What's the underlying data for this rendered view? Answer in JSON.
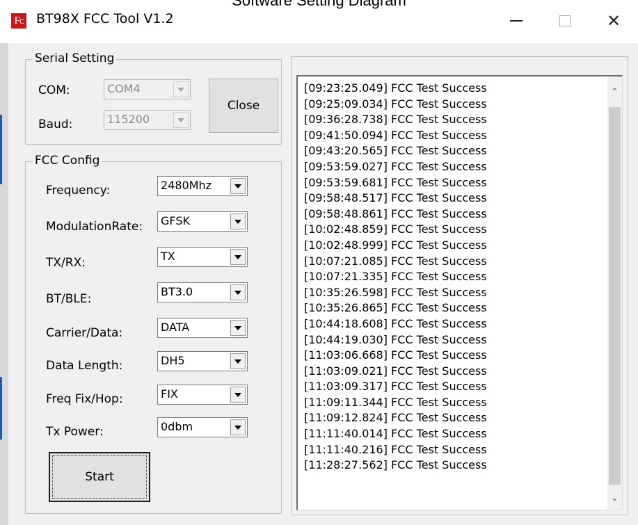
{
  "caption": "Software Setting Diagram",
  "window": {
    "title": "BT98X FCC Tool V1.2",
    "icon_text": "Fc",
    "minimize_icon": "minimize-icon",
    "maximize_icon": "maximize-icon",
    "close_glyph": "✕"
  },
  "serial": {
    "legend": "Serial Setting",
    "com_label": "COM:",
    "com_value": "COM4",
    "baud_label": "Baud:",
    "baud_value": "115200",
    "close_button": "Close"
  },
  "fcc": {
    "legend": "FCC Config",
    "fields": [
      {
        "label": "Frequency:",
        "value": "2480Mhz"
      },
      {
        "label": "ModulationRate:",
        "value": "GFSK"
      },
      {
        "label": "TX/RX:",
        "value": "TX"
      },
      {
        "label": "BT/BLE:",
        "value": "BT3.0"
      },
      {
        "label": "Carrier/Data:",
        "value": "DATA"
      },
      {
        "label": "Data Length:",
        "value": "DH5"
      },
      {
        "label": "Freq Fix/Hop:",
        "value": "FIX"
      },
      {
        "label": "Tx Power:",
        "value": "0dbm"
      }
    ],
    "start_button": "Start"
  },
  "log": {
    "lines": [
      "[09:23:25.049] FCC Test Success",
      "[09:25:09.034] FCC Test Success",
      "[09:36:28.738] FCC Test Success",
      "[09:41:50.094] FCC Test Success",
      "[09:43:20.565] FCC Test Success",
      "[09:53:59.027] FCC Test Success",
      "[09:53:59.681] FCC Test Success",
      "[09:58:48.517] FCC Test Success",
      "[09:58:48.861] FCC Test Success",
      "[10:02:48.859] FCC Test Success",
      "[10:02:48.999] FCC Test Success",
      "[10:07:21.085] FCC Test Success",
      "[10:07:21.335] FCC Test Success",
      "[10:35:26.598] FCC Test Success",
      "[10:35:26.865] FCC Test Success",
      "[10:44:18.608] FCC Test Success",
      "[10:44:19.030] FCC Test Success",
      "[11:03:06.668] FCC Test Success",
      "[11:03:09.021] FCC Test Success",
      "[11:03:09.317] FCC Test Success",
      "[11:09:11.344] FCC Test Success",
      "[11:09:12.824] FCC Test Success",
      "[11:11:40.014] FCC Test Success",
      "[11:11:40.216] FCC Test Success",
      "[11:28:27.562] FCC Test Success"
    ],
    "scroll_up_glyph": "⌃",
    "scroll_down_glyph": "⌄"
  }
}
